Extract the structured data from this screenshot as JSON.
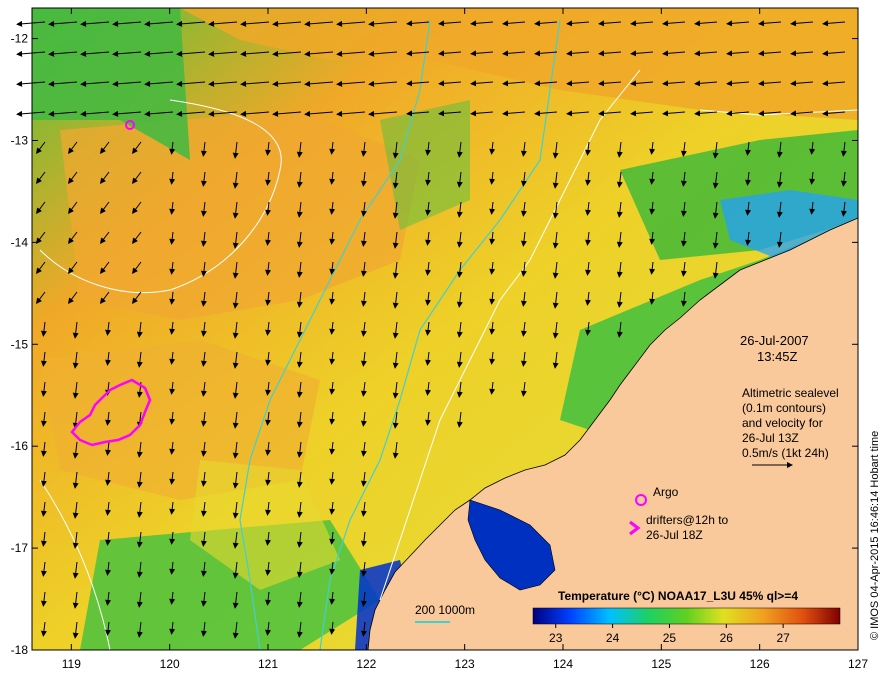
{
  "map": {
    "lon_ticks": [
      "119",
      "120",
      "121",
      "122",
      "123",
      "124",
      "125",
      "126",
      "127"
    ],
    "lat_ticks": [
      "-12",
      "-13",
      "-14",
      "-15",
      "-16",
      "-17",
      "-18"
    ],
    "lon_range": [
      118.6,
      127.0
    ],
    "lat_range": [
      -11.7,
      -18.0
    ]
  },
  "annotations": {
    "date": "26-Jul-2007",
    "time": "13:45Z",
    "altimetry_line1": "Altimetric sealevel",
    "altimetry_line2": "(0.1m contours)",
    "altimetry_line3": "and velocity for",
    "altimetry_line4": "26-Jul 13Z",
    "velocity_scale": "0.5m/s (1kt 24h)",
    "argo_label": "Argo",
    "drifters_line1": "drifters@12h to",
    "drifters_line2": "26-Jul 18Z",
    "depth_label": "200  1000m"
  },
  "colorbar": {
    "title": "Temperature (°C) NOAA17_L3U 45% ql>=4",
    "ticks": [
      "23",
      "24",
      "25",
      "26",
      "27"
    ],
    "tick_values": [
      23,
      24,
      25,
      26,
      27
    ],
    "range": [
      22.6,
      28.0
    ]
  },
  "credit": "© IMOS 04-Apr-2015 16:46:14 Hobart time",
  "colors": {
    "land": "#f9c89b",
    "warm_sst": "#f0a820",
    "mid_sst": "#e8e020",
    "cool_sst": "#40c040",
    "argo_marker": "#ff00ff",
    "depth_contour": "#40d0d0",
    "sealevel_contour": "#ffffff"
  }
}
